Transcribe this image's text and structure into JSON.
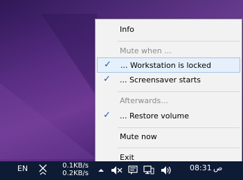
{
  "menu": {
    "items": [
      {
        "label": "Info",
        "checked": false,
        "disabled": false
      },
      {
        "label": "Mute when ...",
        "checked": false,
        "disabled": true
      },
      {
        "label": "... Workstation is locked",
        "checked": true,
        "disabled": false,
        "hovered": true
      },
      {
        "label": "... Screensaver starts",
        "checked": true,
        "disabled": false
      },
      {
        "label": "Afterwards...",
        "checked": false,
        "disabled": true
      },
      {
        "label": "... Restore volume",
        "checked": true,
        "disabled": false
      },
      {
        "label": "Mute now",
        "checked": false,
        "disabled": false
      },
      {
        "label": "Exit",
        "checked": false,
        "disabled": false
      }
    ],
    "check_glyph": "✓"
  },
  "taskbar": {
    "language": "EN",
    "upload_speed": "0.1KB/s",
    "download_speed": "0.2KB/s",
    "time": "08:31",
    "ampm": "ص",
    "tray_icons": [
      "show-hidden-icons-arrow",
      "muted-speaker-icon",
      "notification-icon",
      "network-icon",
      "volume-icon"
    ]
  },
  "colors": {
    "taskbar_bg": "#0e1b35",
    "menu_bg": "#f2f2f2",
    "hover_bg": "#e5f0fb",
    "check": "#1a5bbf"
  }
}
